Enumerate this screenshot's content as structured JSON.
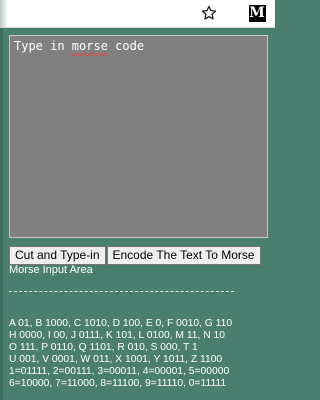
{
  "toolbar": {
    "bookmark_icon": "star-outline-icon",
    "extension_icon": "extension-m-icon",
    "extension_glyph": "M"
  },
  "input_area": {
    "placeholder": "Type in morse code",
    "text_before": "Type in ",
    "misspelled_word": "morse",
    "text_after": " code",
    "background": "#808080"
  },
  "buttons": {
    "cut_and_type": "Cut and Type-in",
    "encode": "Encode The Text To Morse"
  },
  "area_label": "Morse Input Area",
  "legend": {
    "lines": [
      "A 01, B 1000, C 1010, D 100, E 0, F 0010, G 110",
      "H 0000, I 00, J 0111, K 101, L 0100, M 11, N 10",
      "O 111, P 0110, Q 1101, R 010, S 000, T 1",
      "U 001, V 0001, W 011, X 1001, Y 1011, Z 1100",
      "1=01111, 2=00111, 3=00011, 4=00001, 5=00000",
      "6=10000, 7=11000, 8=11100, 9=11110, 0=11111"
    ]
  },
  "colors": {
    "page_background": "#4a7f6f",
    "text": "#ffffff",
    "spellcheck_underline": "#ff3b3b"
  }
}
